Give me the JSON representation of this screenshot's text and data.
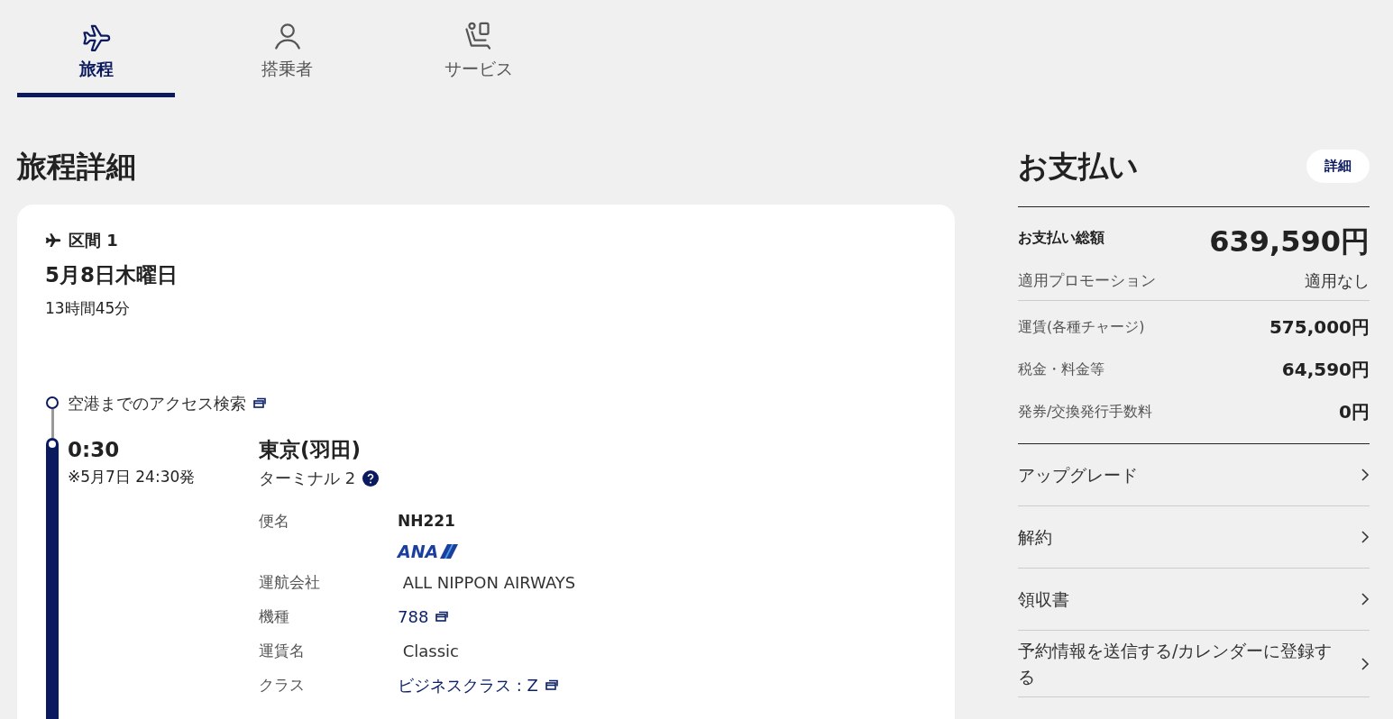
{
  "tabs": [
    {
      "label": "旅程",
      "kind": "plane",
      "selected": true
    },
    {
      "label": "搭乗者",
      "kind": "person",
      "selected": false
    },
    {
      "label": "サービス",
      "kind": "seat",
      "selected": false
    }
  ],
  "itinerary": {
    "title": "旅程詳細",
    "segment": {
      "label": "区間 1",
      "date": "5月8日木曜日",
      "duration": "13時間45分",
      "access_link": "空港までのアクセス検索",
      "departure": {
        "time": "0:30",
        "note": "※5月7日 24:30発",
        "airport": "東京(羽田)",
        "terminal": "ターミナル 2",
        "details": [
          {
            "kind": "bold",
            "label": "便名",
            "value": "NH221"
          },
          {
            "kind": "logo",
            "value": "ANA"
          },
          {
            "kind": "text",
            "label": "運航会社",
            "value": "ALL NIPPON AIRWAYS"
          },
          {
            "kind": "link",
            "label": "機種",
            "value": "788"
          },
          {
            "kind": "text",
            "label": "運賃名",
            "value": "Classic"
          },
          {
            "kind": "link",
            "label": "クラス",
            "value": "ビジネスクラス : Z"
          }
        ]
      }
    }
  },
  "payment": {
    "title": "お支払い",
    "detail_button": "詳細",
    "total": {
      "label": "お支払い総額",
      "amount": "639,590円"
    },
    "promotion": {
      "label": "適用プロモーション",
      "value": "適用なし"
    },
    "charges": [
      {
        "label": "運賃(各種チャージ)",
        "value": "575,000円"
      },
      {
        "label": "税金・料金等",
        "value": "64,590円"
      },
      {
        "label": "発券/交換発行手数料",
        "value": "0円"
      }
    ],
    "links": [
      "アップグレード",
      "解約",
      "領収書",
      "予約情報を送信する/カレンダーに登録する"
    ]
  }
}
